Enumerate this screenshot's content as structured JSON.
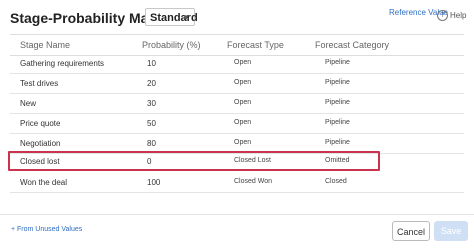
{
  "header": {
    "title": "Stage-Probability Mapping -",
    "layout_select": "Standard",
    "reference_link": "Reference Value",
    "help_icon": "?",
    "help_label": "Help"
  },
  "table": {
    "columns": [
      "Stage Name",
      "Probability (%)",
      "Forecast Type",
      "Forecast Category"
    ],
    "rows": [
      {
        "stage": "Gathering requirements",
        "probability": "10",
        "type": "Open",
        "category": "Pipeline"
      },
      {
        "stage": "Test drives",
        "probability": "20",
        "type": "Open",
        "category": "Pipeline"
      },
      {
        "stage": "New",
        "probability": "30",
        "type": "Open",
        "category": "Pipeline"
      },
      {
        "stage": "Price quote",
        "probability": "50",
        "type": "Open",
        "category": "Pipeline"
      },
      {
        "stage": "Negotiation",
        "probability": "80",
        "type": "Open",
        "category": "Pipeline"
      },
      {
        "stage": "Closed lost",
        "probability": "0",
        "type": "Closed Lost",
        "category": "Omitted"
      },
      {
        "stage": "Won the deal",
        "probability": "100",
        "type": "Closed Won",
        "category": "Closed"
      }
    ]
  },
  "footer": {
    "from_unused": "+ From Unused Values",
    "cancel_label": "Cancel",
    "save_label": "Save"
  },
  "colors": {
    "highlight": "#c9334e",
    "link": "#2f6fc3",
    "save_disabled": "#cfe0f5"
  }
}
